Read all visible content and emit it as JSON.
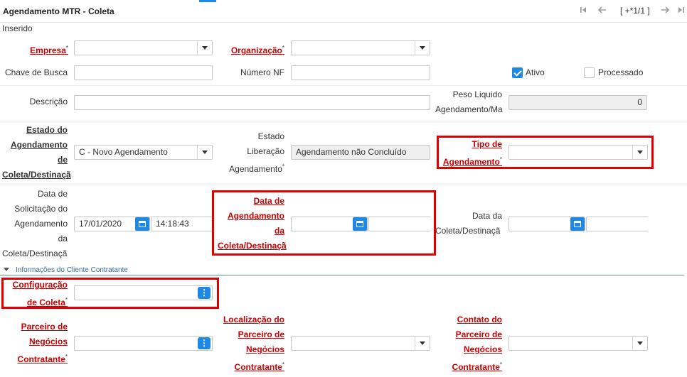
{
  "window": {
    "title": "Agendamento MTR - Coleta",
    "status": "Inserido"
  },
  "pager": {
    "first_icon": "first-page-icon",
    "prev_icon": "previous-icon",
    "label": "[ +*1/1 ]",
    "next_icon": "next-icon",
    "last_icon": "last-page-icon"
  },
  "fields": {
    "empresa": {
      "label": "Empresa",
      "required": "*",
      "value": ""
    },
    "organizacao": {
      "label": "Organização",
      "required": "*",
      "value": ""
    },
    "chave_busca": {
      "label": "Chave de Busca",
      "value": ""
    },
    "numero_nf": {
      "label": "Número NF",
      "value": ""
    },
    "ativo": {
      "label": "Ativo",
      "checked": true
    },
    "processado": {
      "label": "Processado",
      "checked": false
    },
    "descricao": {
      "label": "Descrição",
      "value": ""
    },
    "peso": {
      "label_l1": "Peso Liquido",
      "label_l2": "Agendamento/Ma",
      "value": "0"
    },
    "estado_agendamento": {
      "l1": "Estado do",
      "l2": "Agendamento",
      "l3": "de",
      "l4": "Coleta/Destinaçã",
      "value": "C - Novo Agendamento"
    },
    "estado_liberacao": {
      "l1": "Estado",
      "l2": "Liberação",
      "l3": "Agendamento",
      "required": "*",
      "value": "Agendamento não Concluído"
    },
    "tipo_agendamento": {
      "l1": "Tipo de",
      "l2": "Agendamento",
      "required": "*",
      "value": ""
    },
    "data_solicitacao": {
      "l1": "Data de",
      "l2": "Solicitação do",
      "l3": "Agendamento",
      "l4": "da",
      "l5": "Coleta/Destinaçã",
      "date": "17/01/2020",
      "time": "14:18:43"
    },
    "data_agendamento": {
      "l1": "Data de",
      "l2": "Agendamento",
      "l3": "da",
      "l4": "Coleta/Destinaçã",
      "date": "",
      "time": ""
    },
    "data_coleta": {
      "l1": "Data da",
      "l2": "Coleta/Destinaçã",
      "date": "",
      "time": ""
    },
    "configuracao_coleta": {
      "l1": "Configuração",
      "l2": "de Coleta",
      "required": "*",
      "value": ""
    },
    "parceiro": {
      "l1": "Parceiro de",
      "l2": "Negócios",
      "l3": "Contratante",
      "required": "*",
      "value": ""
    },
    "localizacao": {
      "l1": "Localização do",
      "l2": "Parceiro de",
      "l3": "Negócios",
      "l4": "Contratante",
      "required": "*",
      "value": ""
    },
    "contato": {
      "l1": "Contato do",
      "l2": "Parceiro de",
      "l3": "Negócios",
      "l4": "Contratante",
      "required": "*",
      "value": ""
    }
  },
  "section": {
    "title": "Informações do Cliente Contratante"
  },
  "colors": {
    "accent": "#1e88e5",
    "required": "#cc0000",
    "highlight": "#e00000"
  }
}
